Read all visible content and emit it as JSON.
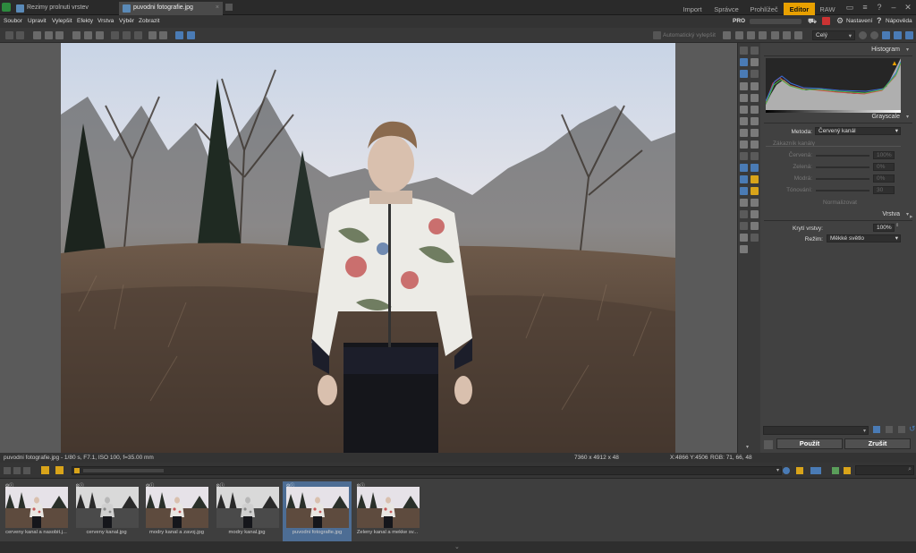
{
  "tabs": [
    {
      "label": "Rezimy prolnuti vrstev",
      "active": false
    },
    {
      "label": "puvodni fotografie.jpg",
      "active": true
    }
  ],
  "modes": [
    {
      "label": "Import",
      "active": false
    },
    {
      "label": "Správce",
      "active": false
    },
    {
      "label": "Prohlížeč",
      "active": false
    },
    {
      "label": "Editor",
      "active": true
    },
    {
      "label": "RAW",
      "active": false
    }
  ],
  "menu": [
    "Soubor",
    "Upravit",
    "Vylepšit",
    "Efekty",
    "Vrstva",
    "Výběr",
    "Zobrazit"
  ],
  "account": {
    "badge": "PRO",
    "settings": "Nastavení",
    "help": "Nápověda"
  },
  "toolbar": {
    "auto_enhance": "Automatický vylepšit",
    "zoom_select": "Celý"
  },
  "panel": {
    "histogram_title": "Histogram",
    "grayscale_title": "Grayscale",
    "method_label": "Metoda:",
    "method_value": "Červený kanál",
    "custom_channels": "Zákazník kanály",
    "red_label": "Červená:",
    "red_value": "100%",
    "green_label": "Zelená:",
    "green_value": "0%",
    "blue_label": "Modrá:",
    "blue_value": "0%",
    "tint_label": "Tónování:",
    "tint_value": "30",
    "normalize_label": "Normalizovat",
    "layer_title": "Vrstva",
    "opacity_label": "Krytí vrstvy:",
    "opacity_value": "100%",
    "mode_label": "Režim:",
    "mode_value": "Měkké světlo"
  },
  "actions": {
    "apply": "Použít",
    "cancel": "Zrušit"
  },
  "status": {
    "fileinfo": "puvodni fotografie.jpg - 1/80 s, F7.1, ISO 100, f=35.00 mm",
    "dimensions": "7360 x 4912 x 48",
    "coords": "X:4866 Y:4506",
    "rgb": "RGB: 71, 66, 48"
  },
  "thumbnails": [
    {
      "label": "cerveny kanal a nasobit.j...",
      "tone": "color",
      "selected": false
    },
    {
      "label": "cerveny kanal.jpg",
      "tone": "gray",
      "selected": false
    },
    {
      "label": "modry kanal a zavoj.jpg",
      "tone": "color",
      "selected": false
    },
    {
      "label": "modry kanal.jpg",
      "tone": "gray",
      "selected": false
    },
    {
      "label": "puvodni fotografie.jpg",
      "tone": "color",
      "selected": true
    },
    {
      "label": "Zeleny kanal a mekke sv...",
      "tone": "color",
      "selected": false
    }
  ]
}
